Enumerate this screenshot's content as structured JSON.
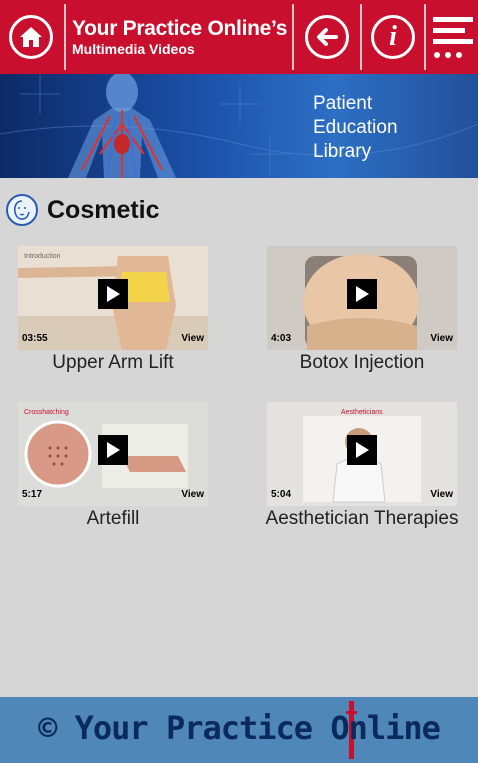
{
  "header": {
    "title": "Your Practice Online’s",
    "subtitle": "Multimedia Videos"
  },
  "banner": {
    "line1": "Patient",
    "line2": "Education",
    "line3": "Library"
  },
  "section": {
    "title": "Cosmetic"
  },
  "videos": [
    {
      "title": "Upper Arm Lift",
      "duration": "03:55",
      "view": "View",
      "thumb_caption": "Introduction"
    },
    {
      "title": "Botox Injection",
      "duration": "4:03",
      "view": "View"
    },
    {
      "title": "Artefill",
      "duration": "5:17",
      "view": "View",
      "thumb_caption": "Crosshatching"
    },
    {
      "title": "Aesthetician Therapies",
      "duration": "5:04",
      "view": "View",
      "thumb_caption": "Aestheticians"
    }
  ],
  "footer": {
    "text": "© Your Practice Online"
  },
  "colors": {
    "header": "#c8102e",
    "footer": "#4f87b8",
    "background": "#d6d6d6"
  }
}
